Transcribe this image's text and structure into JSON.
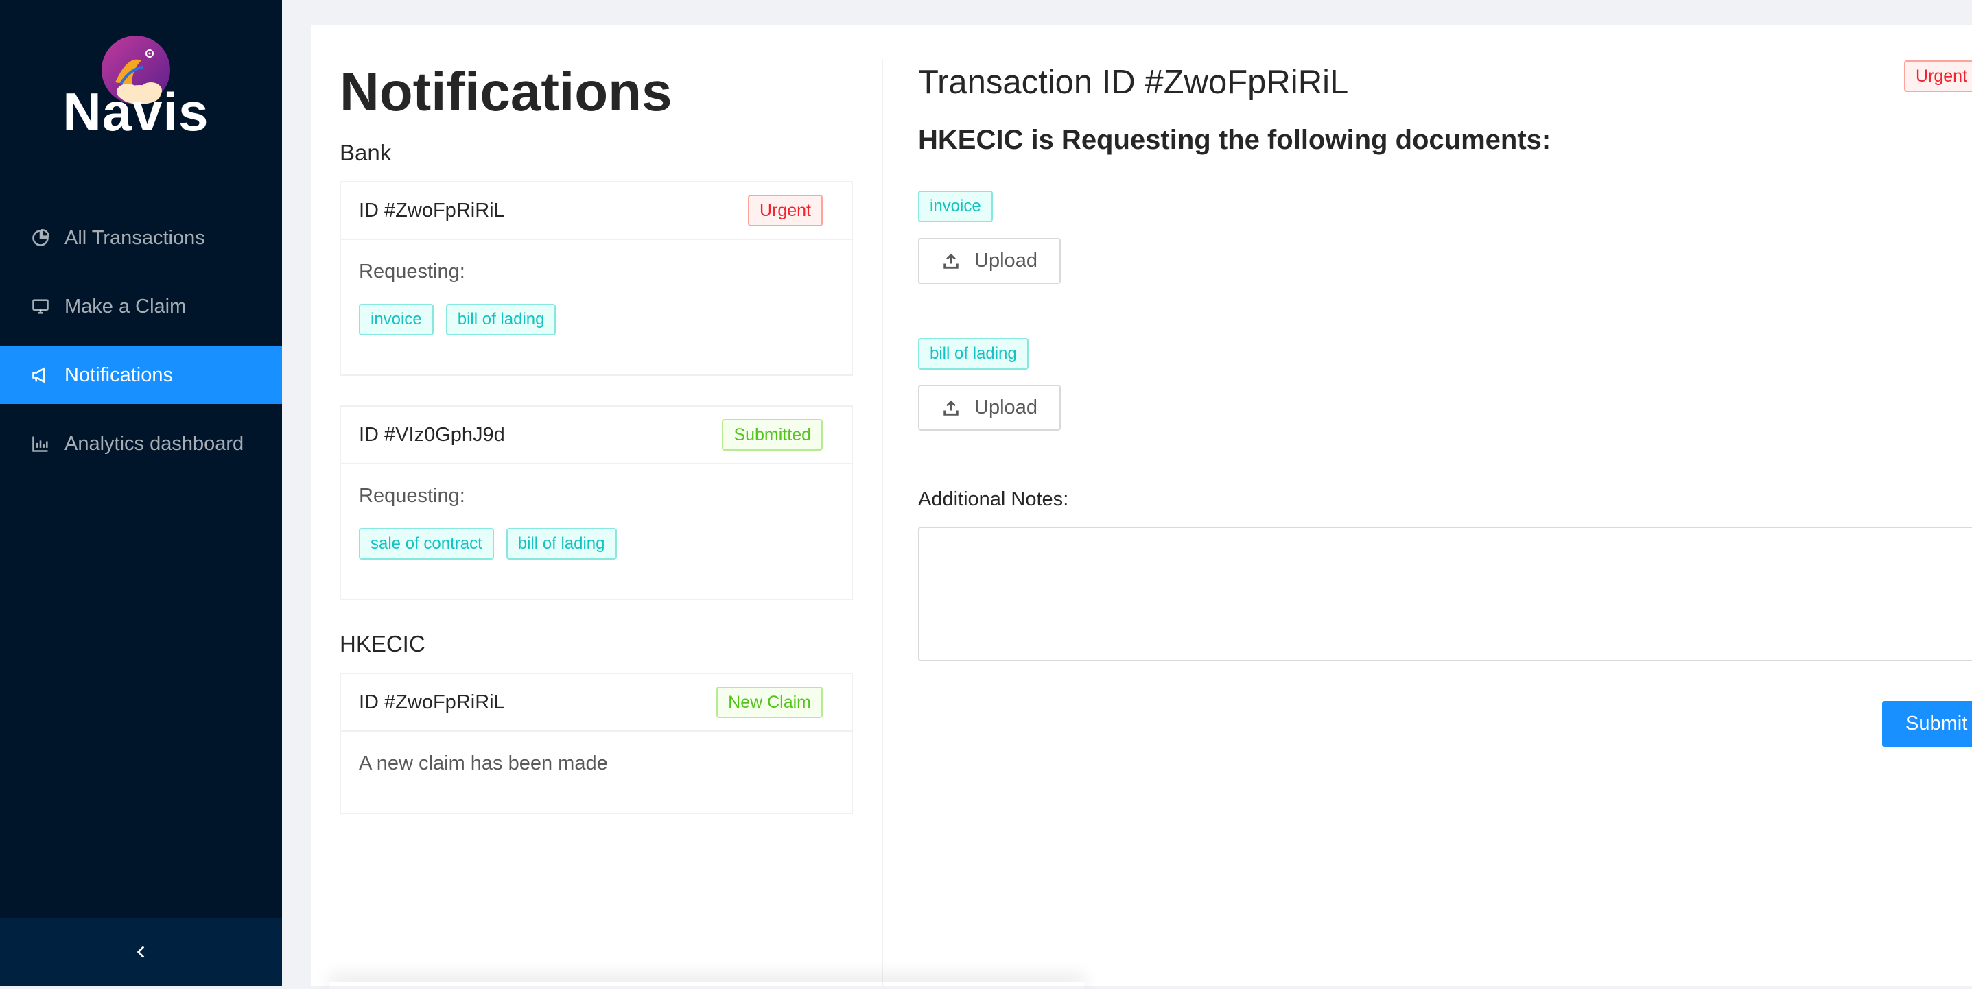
{
  "app": {
    "brand": "Navis"
  },
  "sidebar": {
    "items": [
      {
        "label": "All Transactions",
        "icon": "pie-chart-icon"
      },
      {
        "label": "Make a Claim",
        "icon": "desktop-icon"
      },
      {
        "label": "Notifications",
        "icon": "notification-icon",
        "active": true
      },
      {
        "label": "Analytics dashboard",
        "icon": "bar-chart-icon"
      }
    ],
    "collapse_icon": "chevron-left-icon"
  },
  "notifications": {
    "title": "Notifications",
    "groups": [
      {
        "name": "Bank",
        "cards": [
          {
            "id": "ID #ZwoFpRiRiL",
            "status": "Urgent",
            "status_color": "#f5222d",
            "requesting_label": "Requesting:",
            "tags": [
              "invoice",
              "bill of lading"
            ]
          },
          {
            "id": "ID #VIz0GphJ9d",
            "status": "Submitted",
            "status_color": "#52c41a",
            "requesting_label": "Requesting:",
            "tags": [
              "sale of contract",
              "bill of lading"
            ]
          }
        ]
      },
      {
        "name": "HKECIC",
        "cards": [
          {
            "id": "ID #ZwoFpRiRiL",
            "status": "New Claim",
            "status_color": "#52c41a",
            "message": "A new claim has been made"
          }
        ]
      }
    ]
  },
  "detail": {
    "title": "Transaction ID #ZwoFpRiRiL",
    "status": "Urgent",
    "subtitle": "HKECIC is Requesting the following documents:",
    "documents": [
      {
        "name": "invoice",
        "upload_label": "Upload"
      },
      {
        "name": "bill of lading",
        "upload_label": "Upload"
      }
    ],
    "notes_label": "Additional Notes",
    "notes_value": "",
    "submit_label": "Submit"
  },
  "colors": {
    "sidebar_bg": "#001529",
    "primary": "#1890ff",
    "tag_cyan": "#13c2c2"
  }
}
